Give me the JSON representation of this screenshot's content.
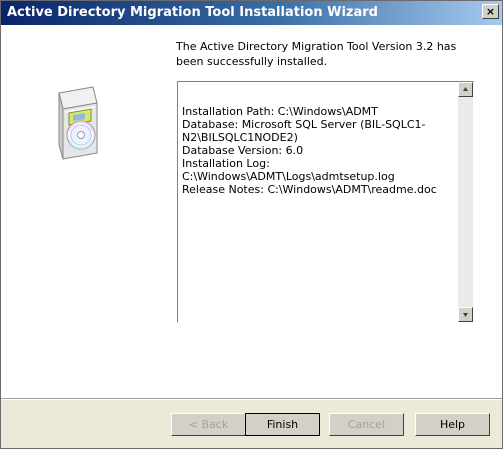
{
  "window": {
    "title": "Active Directory Migration Tool Installation Wizard",
    "close_label": "×"
  },
  "content": {
    "success_message": "The Active Directory Migration Tool Version 3.2 has been successfully installed.",
    "details_text": "Installation Path: C:\\Windows\\ADMT\nDatabase: Microsoft SQL Server (BIL-SQLC1-N2\\BILSQLC1NODE2)\nDatabase Version: 6.0\nInstallation Log: C:\\Windows\\ADMT\\Logs\\admtsetup.log\nRelease Notes: C:\\Windows\\ADMT\\readme.doc"
  },
  "icons": {
    "wizard": "software-box-cd-icon",
    "scroll_up": "scroll-up-arrow-icon",
    "scroll_down": "scroll-down-arrow-icon"
  },
  "buttons": {
    "back": "< Back",
    "finish": "Finish",
    "cancel": "Cancel",
    "help": "Help"
  },
  "colors": {
    "titlebar_start": "#0a246a",
    "titlebar_end": "#a6caf0",
    "dialog_bg": "#ece9d8",
    "content_bg": "#ffffff"
  }
}
